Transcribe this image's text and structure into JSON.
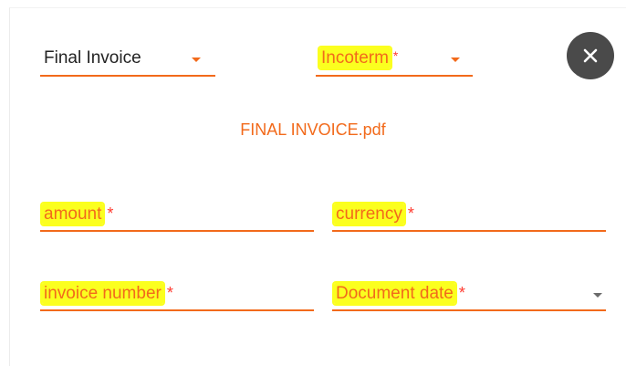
{
  "form": {
    "document_type": {
      "value": "Final Invoice"
    },
    "incoterm": {
      "placeholder": "Incoterm",
      "required_mark": "*"
    },
    "file_name": "FINAL INVOICE.pdf",
    "amount": {
      "placeholder": "amount",
      "required_mark": "*"
    },
    "currency": {
      "placeholder": "currency",
      "required_mark": "*"
    },
    "invoice_number": {
      "placeholder": "invoice number",
      "required_mark": "*"
    },
    "document_date": {
      "placeholder": "Document date",
      "required_mark": "*"
    }
  },
  "icons": {
    "close": "close-icon",
    "dropdown": "caret-down-icon"
  },
  "colors": {
    "accent": "#f26a1b",
    "highlight": "#fbff1f",
    "required": "#ff3b30",
    "close_button": "#4a4a4a"
  }
}
